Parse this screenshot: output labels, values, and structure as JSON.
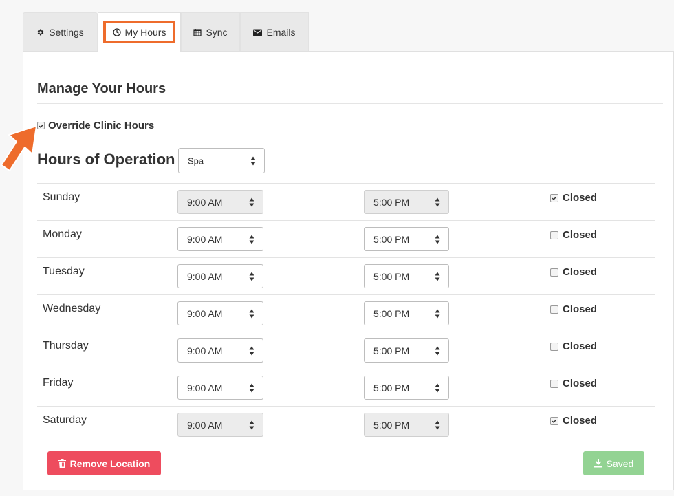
{
  "tabs": [
    {
      "label": "Settings",
      "icon": "gear-icon"
    },
    {
      "label": "My Hours",
      "icon": "clock-icon",
      "active": true
    },
    {
      "label": "Sync",
      "icon": "calendar-icon"
    },
    {
      "label": "Emails",
      "icon": "envelope-icon"
    }
  ],
  "page_title": "Manage Your Hours",
  "override": {
    "label": "Override Clinic Hours",
    "checked": true
  },
  "hours_heading": "Hours of Operation in",
  "location": {
    "selected": "Spa"
  },
  "days": [
    {
      "day": "Sunday",
      "open": "9:00 AM",
      "close": "5:00 PM",
      "closed_label": "Closed",
      "closed": true
    },
    {
      "day": "Monday",
      "open": "9:00 AM",
      "close": "5:00 PM",
      "closed_label": "Closed",
      "closed": false
    },
    {
      "day": "Tuesday",
      "open": "9:00 AM",
      "close": "5:00 PM",
      "closed_label": "Closed",
      "closed": false
    },
    {
      "day": "Wednesday",
      "open": "9:00 AM",
      "close": "5:00 PM",
      "closed_label": "Closed",
      "closed": false
    },
    {
      "day": "Thursday",
      "open": "9:00 AM",
      "close": "5:00 PM",
      "closed_label": "Closed",
      "closed": false
    },
    {
      "day": "Friday",
      "open": "9:00 AM",
      "close": "5:00 PM",
      "closed_label": "Closed",
      "closed": false
    },
    {
      "day": "Saturday",
      "open": "9:00 AM",
      "close": "5:00 PM",
      "closed_label": "Closed",
      "closed": true
    }
  ],
  "buttons": {
    "remove_location": "Remove Location",
    "saved": "Saved"
  },
  "colors": {
    "highlight": "#ee6c2c",
    "danger": "#ee4c5e",
    "success": "#93d393"
  }
}
